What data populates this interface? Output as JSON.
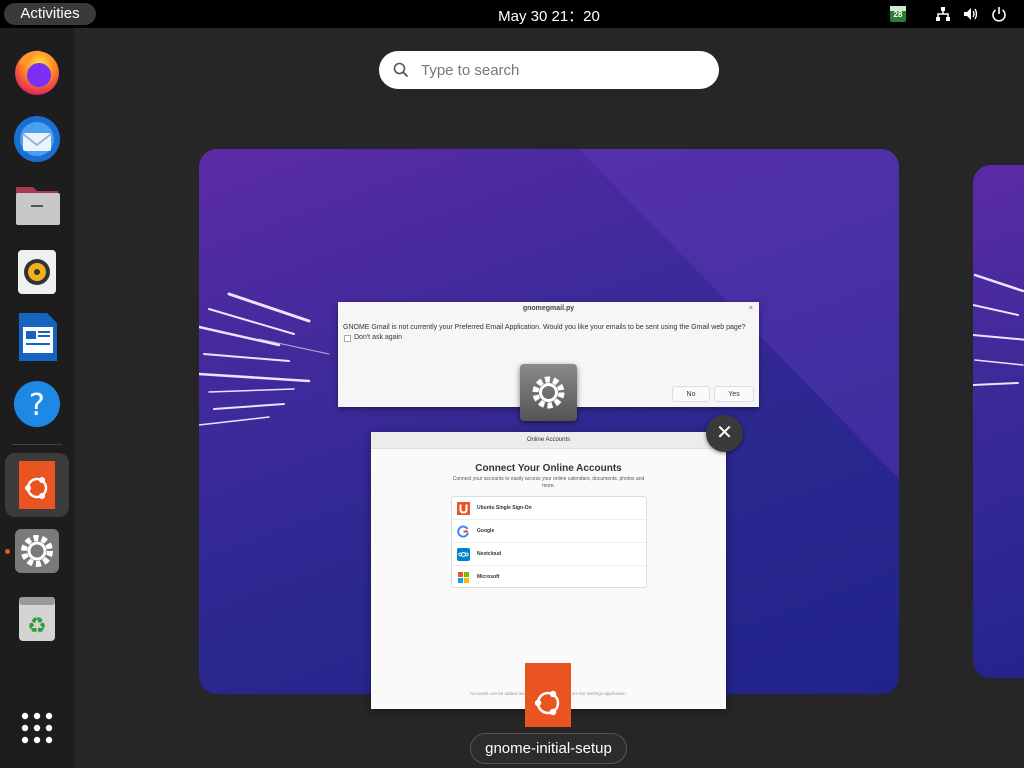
{
  "topbar": {
    "activities_label": "Activities",
    "clock": "May 30  21：20",
    "tray_badge": "28",
    "icons": [
      "calendar-badge-icon",
      "network-icon",
      "volume-icon",
      "power-icon"
    ]
  },
  "dock": {
    "apps": [
      {
        "name": "firefox",
        "icon": "firefox-icon"
      },
      {
        "name": "thunderbird",
        "icon": "thunderbird-icon"
      },
      {
        "name": "files",
        "icon": "files-icon"
      },
      {
        "name": "rhythmbox",
        "icon": "rhythmbox-icon"
      },
      {
        "name": "libreoffice-writer",
        "icon": "writer-icon"
      },
      {
        "name": "help",
        "icon": "help-icon",
        "glyph": "?"
      },
      {
        "name": "ubuntu-initial-setup",
        "icon": "ubuntu-icon",
        "running": true
      },
      {
        "name": "settings",
        "icon": "settings-icon",
        "running": true
      },
      {
        "name": "trash",
        "icon": "trash-icon",
        "glyph": "♻"
      }
    ],
    "show_apps_icon": "app-grid-icon"
  },
  "search": {
    "placeholder": "Type to search"
  },
  "dialog_gmail": {
    "title": "gnomegmail.py",
    "close_glyph": "×",
    "message": "GNOME Gmail is not currently your Preferred Email Application. Would you like your emails to be sent using the Gmail web page?",
    "checkbox_label": "Don't ask again",
    "no_label": "No",
    "yes_label": "Yes"
  },
  "window_close_glyph": "✕",
  "dialog_accounts": {
    "title": "Online Accounts",
    "heading": "Connect Your Online Accounts",
    "subtitle": "Connect your accounts to easily access your online calendars, documents, photos and more.",
    "accounts": [
      {
        "label": "Ubuntu Single Sign-On",
        "icon": "ubuntu-sso-icon",
        "color": "#e95420"
      },
      {
        "label": "Google",
        "icon": "google-icon",
        "color": "#4285f4"
      },
      {
        "label": "Nextcloud",
        "icon": "nextcloud-icon",
        "color": "#0082c9"
      },
      {
        "label": "Microsoft",
        "icon": "microsoft-icon",
        "color": "#f25022"
      }
    ],
    "footer": "Accounts can be added and removed at any time from the Settings application."
  },
  "window_caption": "gnome-initial-setup",
  "colors": {
    "ubuntu_orange": "#e95420",
    "panel_black": "#000000",
    "overview_bg": "#262626",
    "wallpaper_purple": "#4a2aa0"
  }
}
